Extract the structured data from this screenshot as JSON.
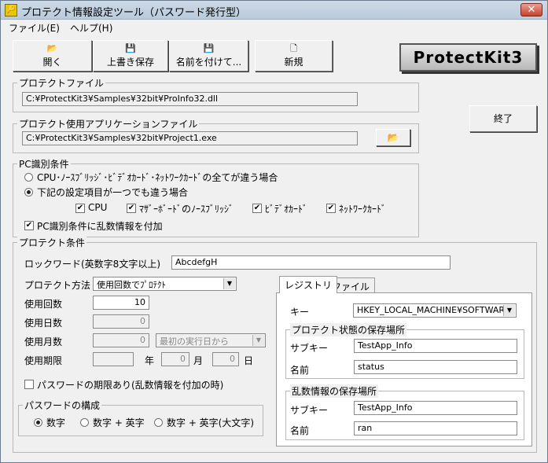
{
  "window": {
    "title": "プロテクト情報設定ツール（パスワード発行型）",
    "close_glyph": "✕",
    "app_icon": "lock-key-icon"
  },
  "menu": {
    "file": "ファイル(E)",
    "help": "ヘルプ(H)"
  },
  "toolbar": {
    "open": "開く",
    "save": "上書き保存",
    "save_as": "名前を付けて...",
    "new": "新規"
  },
  "logo": "ProtectKit3",
  "protect_file": {
    "label": "プロテクトファイル",
    "value": "C:¥ProtectKit3¥Samples¥32bit¥ProInfo32.dll"
  },
  "app_file": {
    "label": "プロテクト使用アプリケーションファイル",
    "value": "C:¥ProtectKit3¥Samples¥32bit¥Project1.exe"
  },
  "exit_button": "終了",
  "pc_id": {
    "label": "PC識別条件",
    "radio1": "CPU･ﾉｰｽﾌﾞﾘｯｼﾞ･ﾋﾞﾃﾞｵｶｰﾄﾞ･ﾈｯﾄﾜｰｸｶｰﾄﾞの全てが違う場合",
    "radio2": "下記の設定項目が一つでも違う場合",
    "cb_cpu": "CPU",
    "cb_mb": "ﾏｻﾞｰﾎﾞｰﾄﾞのﾉｰｽﾌﾞﾘｯｼﾞ",
    "cb_video": "ﾋﾞﾃﾞｵｶｰﾄﾞ",
    "cb_net": "ﾈｯﾄﾜｰｸｶｰﾄﾞ",
    "cb_random": "PC識別条件に乱数情報を付加"
  },
  "protect": {
    "label": "プロテクト条件",
    "lockword_label": "ロックワード(英数字8文字以上)",
    "lockword_value": "AbcdefgH",
    "method_label": "プロテクト方法",
    "method_value": "使用回数でﾌﾟﾛﾃｸﾄ",
    "count_label": "使用回数",
    "count_value": "10",
    "days_label": "使用日数",
    "days_value": "0",
    "months_label": "使用月数",
    "months_value": "0",
    "months_combo": "最初の実行日から",
    "expiry_label": "使用期限",
    "expiry_year": "",
    "expiry_month": "0",
    "expiry_day": "0",
    "year_unit": "年",
    "month_unit": "月",
    "day_unit": "日",
    "pw_expiry": "パスワードの期限あり(乱数情報を付加の時)",
    "pw_struct_label": "パスワードの構成",
    "pw_num": "数字",
    "pw_num_en": "数字 + 英字",
    "pw_num_en_upper": "数字 + 英字(大文字)"
  },
  "tabs": {
    "registry": "レジストリ",
    "file": "ファイル"
  },
  "registry": {
    "key_label": "キー",
    "key_value": "HKEY_LOCAL_MACHINE¥SOFTWARE",
    "protect_state_label": "プロテクト状態の保存場所",
    "subkey_label": "サブキー",
    "subkey_value": "TestApp_Info",
    "name_label": "名前",
    "name_value": "status",
    "random_label": "乱数情報の保存場所",
    "subkey2_label": "サブキー",
    "subkey2_value": "TestApp_Info",
    "name2_label": "名前",
    "name2_value": "ran"
  }
}
